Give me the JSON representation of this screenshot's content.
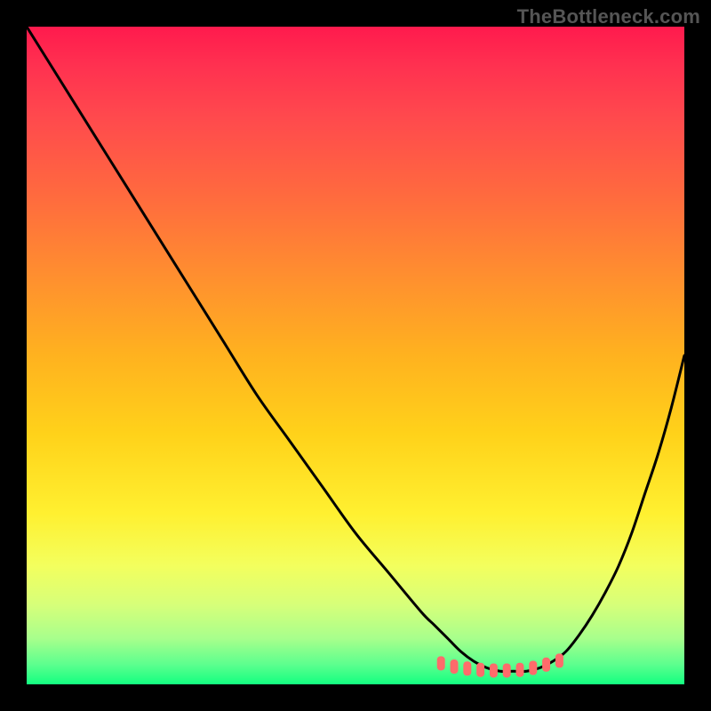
{
  "watermark": {
    "text": "TheBottleneck.com"
  },
  "chart_data": {
    "type": "line",
    "title": "",
    "xlabel": "",
    "ylabel": "",
    "xlim": [
      0,
      100
    ],
    "ylim": [
      0,
      100
    ],
    "grid": false,
    "legend": false,
    "annotations": [],
    "background_colormap": "red-green-vertical",
    "series": [
      {
        "name": "bottleneck-curve",
        "color": "#000000",
        "x": [
          0,
          5,
          10,
          15,
          20,
          25,
          30,
          35,
          40,
          45,
          50,
          55,
          60,
          62,
          64,
          66,
          68,
          70,
          72,
          74,
          76,
          78,
          80,
          82,
          84,
          86,
          88,
          90,
          92,
          94,
          96,
          98,
          100
        ],
        "y": [
          100,
          92,
          84,
          76,
          68,
          60,
          52,
          44,
          37,
          30,
          23,
          17,
          11,
          9,
          7,
          5,
          3.5,
          2.5,
          2,
          2,
          2,
          2.5,
          3.5,
          5,
          7.5,
          10.5,
          14,
          18,
          23,
          29,
          35,
          42,
          50
        ]
      }
    ],
    "markers": [
      {
        "name": "flat-region-markers",
        "color": "#ff6b6b",
        "shape": "rounded-rect",
        "points": [
          {
            "x": 63,
            "y": 3.2
          },
          {
            "x": 65,
            "y": 2.7
          },
          {
            "x": 67,
            "y": 2.4
          },
          {
            "x": 69,
            "y": 2.2
          },
          {
            "x": 71,
            "y": 2.1
          },
          {
            "x": 73,
            "y": 2.1
          },
          {
            "x": 75,
            "y": 2.2
          },
          {
            "x": 77,
            "y": 2.5
          },
          {
            "x": 79,
            "y": 3.0
          },
          {
            "x": 81,
            "y": 3.6
          }
        ]
      }
    ]
  }
}
